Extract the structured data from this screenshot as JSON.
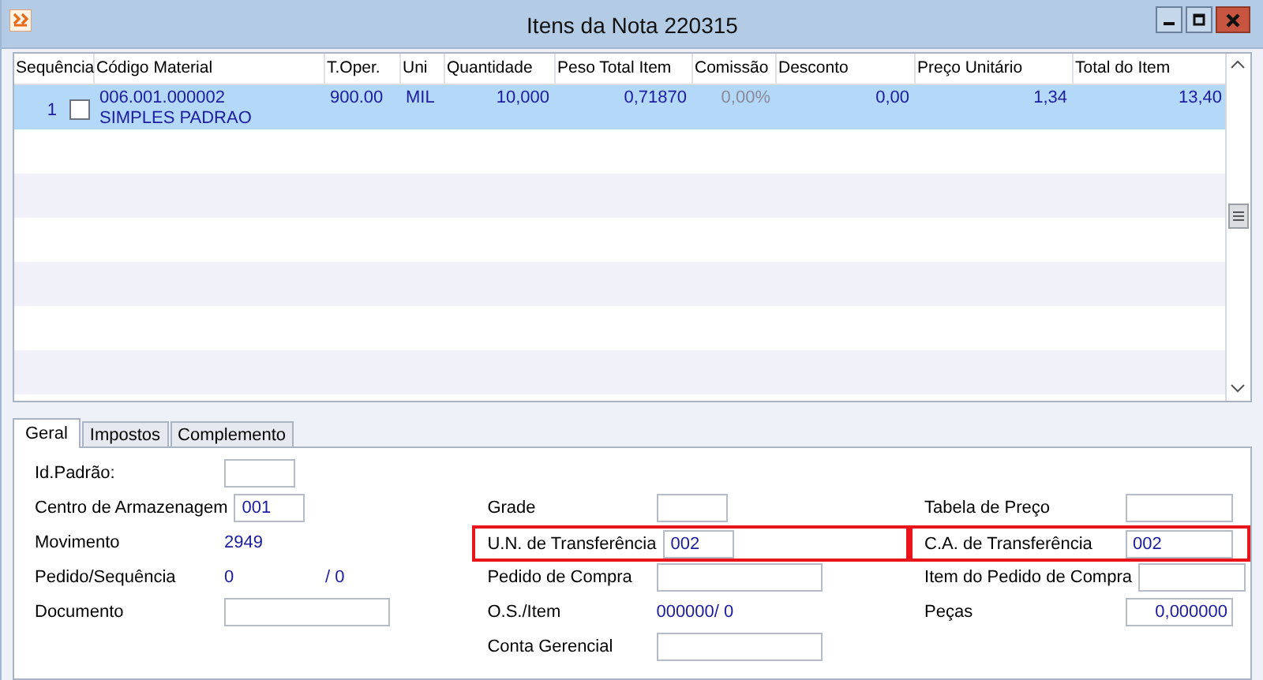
{
  "window": {
    "title": "Itens da Nota 220315"
  },
  "grid": {
    "columns": [
      {
        "label": "Sequência",
        "disabled": false
      },
      {
        "label": "Código Material",
        "disabled": false
      },
      {
        "label": "T.Oper.",
        "disabled": false
      },
      {
        "label": "Uni",
        "disabled": false
      },
      {
        "label": "Quantidade",
        "disabled": false
      },
      {
        "label": "Peso Total Item",
        "disabled": false
      },
      {
        "label": "Comissão",
        "disabled": true
      },
      {
        "label": "Desconto",
        "disabled": false
      },
      {
        "label": "Preço Unitário",
        "disabled": false
      },
      {
        "label": "Total do Item",
        "disabled": false
      }
    ],
    "rows": [
      {
        "selected": true,
        "checked": false,
        "sequence": "1",
        "code": "006.001.000002",
        "description": "SIMPLES PADRAO",
        "values": [
          "900.00",
          "MIL",
          "10,000",
          "0,71870",
          "0,00%",
          "0,00",
          "1,34",
          "13,40"
        ]
      }
    ]
  },
  "tabs": [
    {
      "label": "Geral",
      "selected": true
    },
    {
      "label": "Impostos",
      "selected": false
    },
    {
      "label": "Complemento",
      "selected": false
    }
  ],
  "form": {
    "columns": [
      [
        {
          "label": "Id.Padrão:",
          "kind": "small-box",
          "highlighted": false
        },
        {
          "label": "Centro de Armazenagem",
          "kind": "small-box",
          "value": "001",
          "highlighted": false
        },
        {
          "label": "Movimento",
          "kind": "value",
          "value": "2949",
          "highlighted": false
        },
        {
          "label": "Pedido/Sequência",
          "kind": "pair",
          "value": "0",
          "suffix": "/ 0",
          "highlighted": false
        },
        {
          "label": "Documento",
          "kind": "wide-box",
          "highlighted": false
        }
      ],
      [
        {
          "label": "Grade",
          "kind": "small-box",
          "highlighted": false
        },
        {
          "label": "U.N. de Transferência",
          "kind": "small-box",
          "value": "002",
          "highlighted": true
        },
        {
          "label": "Pedido de Compra",
          "kind": "wide-box",
          "highlighted": false
        },
        {
          "label": "O.S./Item",
          "kind": "pair",
          "value": "000000",
          "suffix": "/ 0",
          "highlighted": false
        },
        {
          "label": "Conta Gerencial",
          "kind": "wide-box",
          "highlighted": false
        }
      ],
      [
        {
          "label": "Tabela de Preço",
          "kind": "box",
          "highlighted": false
        },
        {
          "label": "C.A. de Transferência",
          "kind": "box",
          "value": "002",
          "highlighted": true
        },
        {
          "label": "Item do Pedido de Compra",
          "kind": "box",
          "highlighted": false
        },
        {
          "label": "Peças",
          "kind": "number-box",
          "value": "0,000000",
          "highlighted": false
        }
      ]
    ]
  }
}
